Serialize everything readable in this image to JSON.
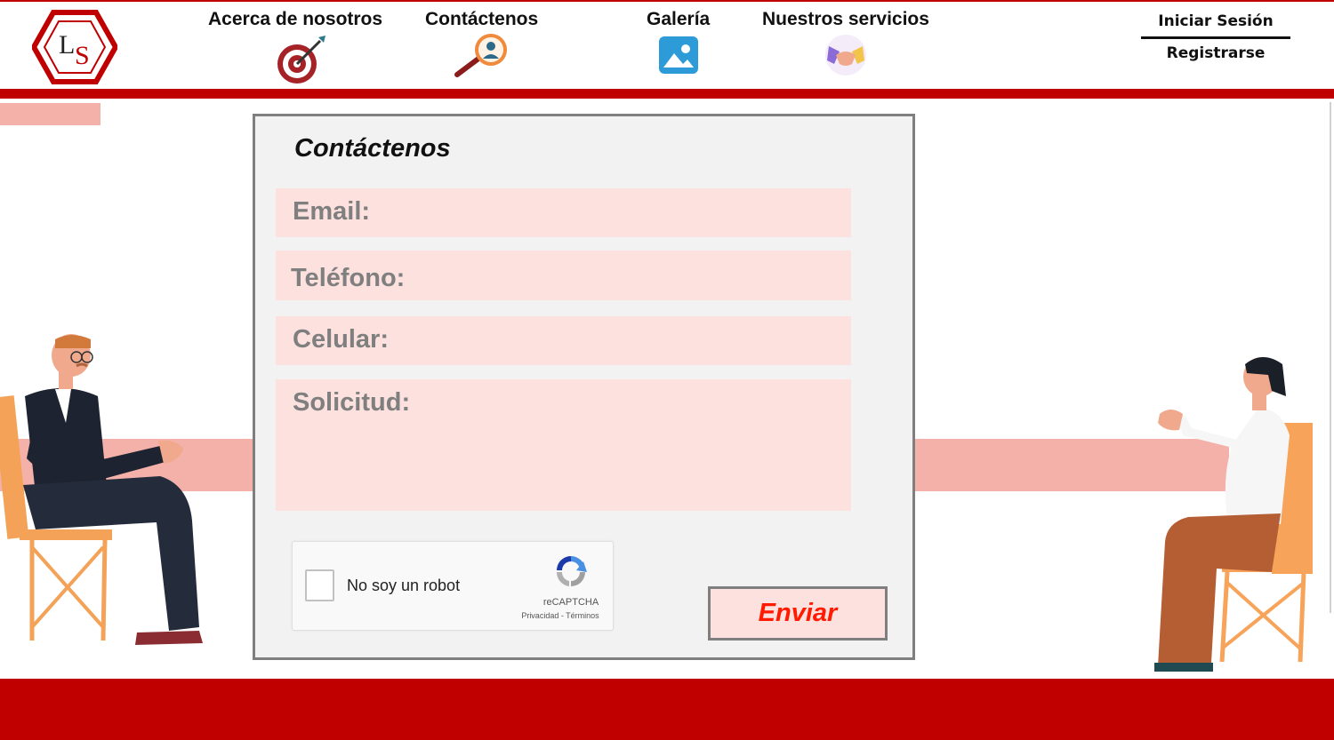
{
  "brand": {
    "logo_text": "LS",
    "logo_color": "#c00000"
  },
  "nav": {
    "items": [
      {
        "label": "Acerca de nosotros",
        "icon": "target-dart-icon"
      },
      {
        "label": "Contáctenos",
        "icon": "magnifier-person-icon"
      },
      {
        "label": "Galería",
        "icon": "gallery-image-icon"
      },
      {
        "label": "Nuestros servicios",
        "icon": "handshake-icon"
      }
    ]
  },
  "auth": {
    "login_label": "Iniciar Sesión",
    "register_label": "Registrarse"
  },
  "form": {
    "title": "Contáctenos",
    "fields": {
      "email": "Email:",
      "phone": "Teléfono:",
      "mobile": "Celular:",
      "request": "Solicitud:"
    },
    "captcha": {
      "label": "No soy un robot",
      "brand": "reCAPTCHA",
      "terms": "Privacidad - Términos"
    },
    "submit_label": "Enviar"
  },
  "colors": {
    "primary_red": "#c00000",
    "accent_pink": "#f4b1a9",
    "field_bg": "#fce1de",
    "submit_text": "#ff1a00"
  }
}
